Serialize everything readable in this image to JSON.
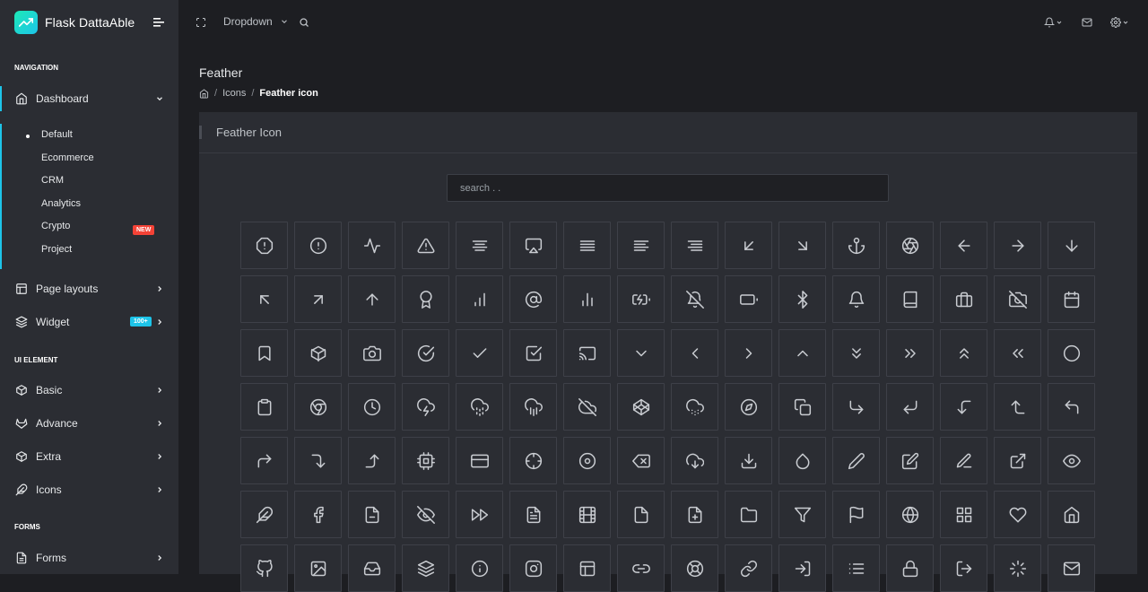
{
  "brand": {
    "name": "Flask DattaAble"
  },
  "sidebar": {
    "captions": [
      "NAVIGATION",
      "UI ELEMENT",
      "FORMS"
    ],
    "dashboard": {
      "label": "Dashboard"
    },
    "submenu": [
      {
        "label": "Default"
      },
      {
        "label": "Ecommerce"
      },
      {
        "label": "CRM"
      },
      {
        "label": "Analytics"
      },
      {
        "label": "Crypto",
        "badge": "NEW"
      },
      {
        "label": "Project"
      }
    ],
    "items": [
      {
        "label": "Page layouts"
      },
      {
        "label": "Widget",
        "badge": "100+"
      },
      {
        "label": "Basic"
      },
      {
        "label": "Advance"
      },
      {
        "label": "Extra"
      },
      {
        "label": "Icons"
      },
      {
        "label": "Forms"
      }
    ]
  },
  "header": {
    "dropdown_label": "Dropdown"
  },
  "page": {
    "title": "Feather",
    "breadcrumb": [
      "Icons",
      "Feather icon"
    ]
  },
  "card": {
    "title": "Feather Icon",
    "search_placeholder": "search . ."
  },
  "colors": {
    "accent": "#1dc4e9",
    "badge_new": "#f44236",
    "badge_count": "#1dc4e9",
    "background": "#1d1e22",
    "panel": "#2b2d33"
  },
  "icons": [
    "alert-octagon",
    "alert-circle",
    "activity",
    "alert-triangle",
    "align-center",
    "airplay",
    "align-justify",
    "align-left",
    "align-right",
    "arrow-down-left",
    "arrow-down-right",
    "anchor",
    "aperture",
    "arrow-left",
    "arrow-right",
    "arrow-down",
    "arrow-up-left",
    "arrow-up-right",
    "arrow-up",
    "award",
    "bar-chart",
    "at-sign",
    "bar-chart-2",
    "battery-charging",
    "bell-off",
    "battery",
    "bluetooth",
    "bell",
    "book",
    "briefcase",
    "camera-off",
    "calendar",
    "bookmark",
    "box",
    "camera",
    "check-circle",
    "check",
    "check-square",
    "cast",
    "chevron-down",
    "chevron-left",
    "chevron-right",
    "chevron-up",
    "chevrons-down",
    "chevrons-right",
    "chevrons-up",
    "chevrons-left",
    "circle",
    "clipboard",
    "chrome",
    "clock",
    "cloud-lightning",
    "cloud-drizzle",
    "cloud-rain",
    "cloud-off",
    "codepen",
    "cloud-snow",
    "compass",
    "copy",
    "corner-down-right",
    "corner-down-left",
    "corner-left-down",
    "corner-left-up",
    "corner-up-left",
    "corner-up-right",
    "corner-right-down",
    "corner-right-up",
    "cpu",
    "credit-card",
    "crosshair",
    "disc",
    "delete",
    "download-cloud",
    "download",
    "droplet",
    "edit-2",
    "edit",
    "edit-3",
    "external-link",
    "eye",
    "feather",
    "facebook",
    "file-minus",
    "eye-off",
    "fast-forward",
    "file-text",
    "film",
    "file",
    "file-plus",
    "folder",
    "filter",
    "flag",
    "globe",
    "grid",
    "heart",
    "home",
    "github",
    "image",
    "inbox",
    "layers",
    "info",
    "instagram",
    "layout",
    "link-2",
    "life-buoy",
    "link",
    "log-in",
    "list",
    "lock",
    "log-out",
    "loader",
    "mail"
  ]
}
